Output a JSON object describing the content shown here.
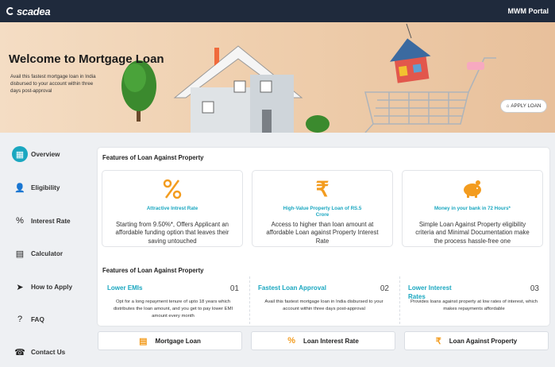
{
  "header": {
    "brand": "scadea",
    "portal_label": "MWM Portal"
  },
  "hero": {
    "title": "Welcome to Mortgage Loan",
    "subtitle": "Avail this fastest mortgage loan in India disbursed to your account within three days post-approval",
    "apply_label": "APPLY LOAN"
  },
  "sidebar": {
    "items": [
      {
        "label": "Overview",
        "icon": "grid-icon",
        "active": true
      },
      {
        "label": "Eligibility",
        "icon": "user-check-icon"
      },
      {
        "label": "Interest Rate",
        "icon": "percent-icon"
      },
      {
        "label": "Calculator",
        "icon": "calculator-icon"
      },
      {
        "label": "How to Apply",
        "icon": "send-icon"
      },
      {
        "label": "FAQ",
        "icon": "question-icon"
      },
      {
        "label": "Contact Us",
        "icon": "phone-icon"
      }
    ]
  },
  "features": {
    "title": "Features of Loan Against Property",
    "cards": [
      {
        "heading": "Attractive Intrest Rate",
        "body": "Starting from 9.50%*, Offers Applicant an affordable funding option that leaves their saving untouched",
        "icon": "percent-icon"
      },
      {
        "heading": "High-Value Property Loan of RS.5 Crore",
        "body": "Access to higher than loan amount at affordable Loan against Property Interest Rate",
        "icon": "rupee-icon"
      },
      {
        "heading": "Money in your bank in 72 Hours*",
        "body": "Simple Loan Against Property eligibility criteria and Minimal Documentation make the process hassle-free one",
        "icon": "piggy-bank-icon"
      }
    ]
  },
  "features2": {
    "title": "Features of Loan Against Property",
    "items": [
      {
        "title": "Lower EMIs",
        "num": "01",
        "text": "Opt for a long repayment tenure of upto 18 years which distributes the loan amount, and you get to pay lower EMI amount every month"
      },
      {
        "title": "Fastest Loan Approval",
        "num": "02",
        "text": "Avail this fastest mortgage loan in India disbursed to your account within three days post-approval"
      },
      {
        "title": "Lower Interest Rates",
        "num": "03",
        "text": "Provides loans against property at low rates of interest, which makes repayments affordable"
      }
    ]
  },
  "bottom_buttons": [
    {
      "label": "Mortgage Loan",
      "icon": "calculator-icon"
    },
    {
      "label": "Loan Interest Rate",
      "icon": "percent-icon"
    },
    {
      "label": "Loan Against Property",
      "icon": "rupee-icon"
    }
  ],
  "colors": {
    "accent": "#1aa7c0",
    "orange": "#f39c1f",
    "topbar": "#1f2a3c"
  }
}
